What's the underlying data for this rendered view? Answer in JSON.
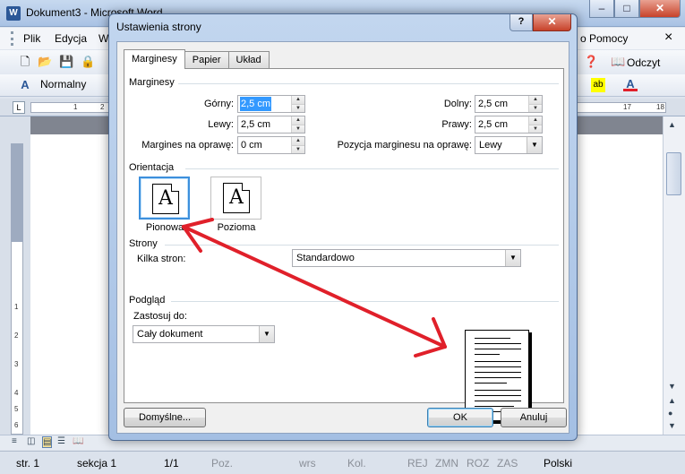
{
  "word": {
    "title": "Dokument3 - Microsoft Word",
    "app_icon_letter": "W",
    "window_buttons": {
      "minimize": "–",
      "maximize": "□",
      "close": "✕"
    },
    "menu": [
      "Plik",
      "Edycja",
      "W"
    ],
    "menu_help_partial": "o Pomocy",
    "menu_close": "×",
    "style_name": "Normalny",
    "read_button": "Odczyt",
    "ruler_numbers": [
      "1",
      "2",
      "17",
      "18"
    ],
    "left_ruler_numbers": [
      "1",
      "2",
      "3",
      "4",
      "5",
      "6"
    ]
  },
  "status": {
    "page": "str. 1",
    "section": "sekcja 1",
    "pages": "1/1",
    "pos": "Poz.",
    "line": "wrs",
    "col": "Kol.",
    "rec": "REJ",
    "trk": "ZMN",
    "ext": "ROZ",
    "ovr": "ZAS",
    "language": "Polski"
  },
  "dialog": {
    "title": "Ustawienia strony",
    "help_button": "?",
    "close_button": "✕",
    "tabs": [
      {
        "label": "Marginesy",
        "active": true
      },
      {
        "label": "Papier",
        "active": false
      },
      {
        "label": "Układ",
        "active": false
      }
    ],
    "margins_group": "Marginesy",
    "fields": {
      "top": {
        "label": "Górny:",
        "value": "2,5 cm"
      },
      "bottom": {
        "label": "Dolny:",
        "value": "2,5 cm"
      },
      "left": {
        "label": "Lewy:",
        "value": "2,5 cm"
      },
      "right": {
        "label": "Prawy:",
        "value": "2,5 cm"
      },
      "gutter": {
        "label": "Margines na oprawę:",
        "value": "0 cm"
      },
      "gutter_pos": {
        "label": "Pozycja marginesu na oprawę:",
        "value": "Lewy"
      }
    },
    "orientation_group": "Orientacja",
    "orientation": {
      "portrait": "Pionowa",
      "landscape": "Pozioma",
      "glyph": "A",
      "selected": "portrait"
    },
    "pages_group": "Strony",
    "multiple_pages": {
      "label": "Kilka stron:",
      "value": "Standardowo"
    },
    "preview_group": "Podgląd",
    "apply_to": {
      "label": "Zastosuj do:",
      "value": "Cały dokument"
    },
    "buttons": {
      "default": "Domyślne...",
      "ok": "OK",
      "cancel": "Anuluj"
    }
  },
  "colors": {
    "annotation_arrow": "#e0202a",
    "selection": "#3399ff",
    "dialog_frame": "#a4bfe3"
  }
}
